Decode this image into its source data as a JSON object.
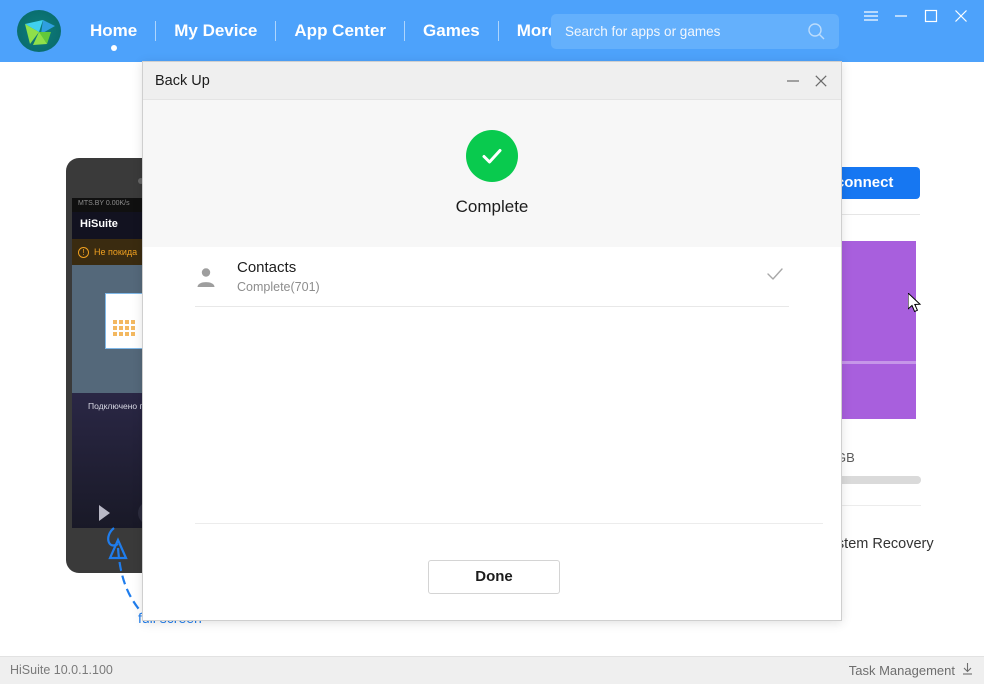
{
  "app": {
    "logo_icon": "hisuite-logo-icon",
    "nav_items": [
      {
        "label": "Home",
        "active": true
      },
      {
        "label": "My Device",
        "active": false
      },
      {
        "label": "App Center",
        "active": false
      },
      {
        "label": "Games",
        "active": false
      },
      {
        "label": "More",
        "active": false
      }
    ],
    "search": {
      "placeholder": "Search for apps or games",
      "value": "",
      "icon": "search-icon"
    },
    "window_controls": [
      {
        "name": "menu-icon",
        "glyph": "☰"
      },
      {
        "name": "minimize-icon",
        "glyph": "–"
      },
      {
        "name": "maximize-icon",
        "glyph": "□"
      },
      {
        "name": "close-icon",
        "glyph": "✕"
      }
    ],
    "accent_color": "#4da2fb",
    "success_color": "#09ca4e"
  },
  "background": {
    "phone": {
      "status_text": "MTS.BY  0.00K/s",
      "app_title": "HiSuite",
      "warning_text": "Не покида",
      "connected_text": "Подключено п",
      "nav_back_icon": "nav-back-triangle-icon",
      "home_circle_icon": "nav-home-icon"
    },
    "annotation_label": "full screen",
    "annotation_color": "#1f7ded",
    "disconnect_button": "Disconnect",
    "storage_unit": "GB",
    "system_recovery": "System Recovery",
    "cursor_icon": "mouse-pointer-icon"
  },
  "dialog": {
    "title": "Back Up",
    "minimize_icon": "minimize-icon",
    "close_icon": "close-icon",
    "status_icon": "success-check-icon",
    "status_label": "Complete",
    "items": [
      {
        "icon": "contact-person-icon",
        "name": "Contacts",
        "status": "Complete(701)",
        "done_icon": "check-icon"
      }
    ],
    "done_button": "Done"
  },
  "statusbar": {
    "version": "HiSuite 10.0.1.100",
    "task_management": "Task Management",
    "task_icon": "download-arrow-icon"
  }
}
